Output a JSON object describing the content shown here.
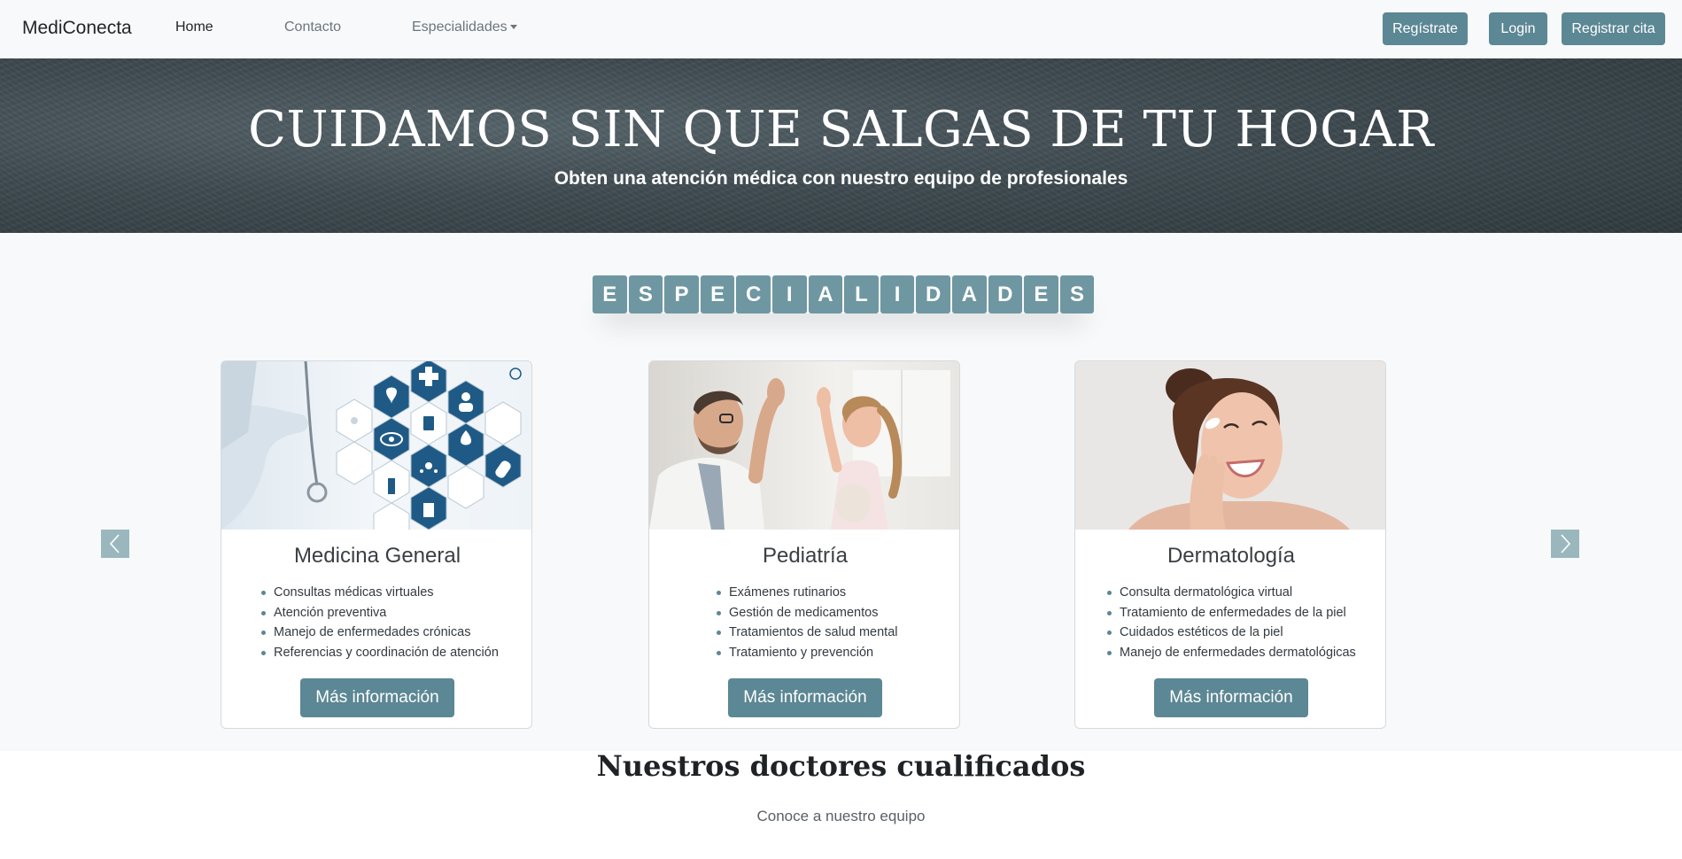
{
  "navbar": {
    "brand": "MediConecta",
    "links": [
      "Home",
      "Contacto",
      "Especialidades"
    ],
    "buttons": [
      "Regístrate",
      "Login",
      "Registrar cita"
    ]
  },
  "hero": {
    "title": "CUIDAMOS SIN QUE SALGAS DE TU HOGAR",
    "subtitle": "Obten una atención médica con nuestro equipo de profesionales"
  },
  "specialties": {
    "heading_letters": [
      "E",
      "S",
      "P",
      "E",
      "C",
      "I",
      "A",
      "L",
      "I",
      "D",
      "A",
      "D",
      "E",
      "S"
    ],
    "cards": [
      {
        "title": "Medicina General",
        "items": [
          "Consultas médicas virtuales",
          "Atención preventiva",
          "Manejo de enfermedades crónicas",
          "Referencias y coordinación de atención"
        ],
        "button": "Más información",
        "image": "medical-hexagon-icons-image"
      },
      {
        "title": "Pediatría",
        "items": [
          "Exámenes rutinarios",
          "Gestión de medicamentos",
          "Tratamientos de salud mental",
          "Tratamiento y prevención"
        ],
        "button": "Más información",
        "image": "doctor-high-five-child-image"
      },
      {
        "title": "Dermatología",
        "items": [
          "Consulta dermatológica virtual",
          "Tratamiento de enfermedades de la piel",
          "Cuidados estéticos de la piel",
          "Manejo de enfermedades dermatológicas"
        ],
        "button": "Más información",
        "image": "smiling-woman-skin-care-image"
      }
    ],
    "prev_icon": "chevron-left-icon",
    "next_icon": "chevron-right-icon"
  },
  "doctors": {
    "title": "Nuestros doctores cualificados",
    "subtitle": "Conoce a nuestro equipo"
  },
  "colors": {
    "accent": "#5c8794",
    "hero_bg": "#3f4b51",
    "letter_tile": "#6f97a2"
  }
}
